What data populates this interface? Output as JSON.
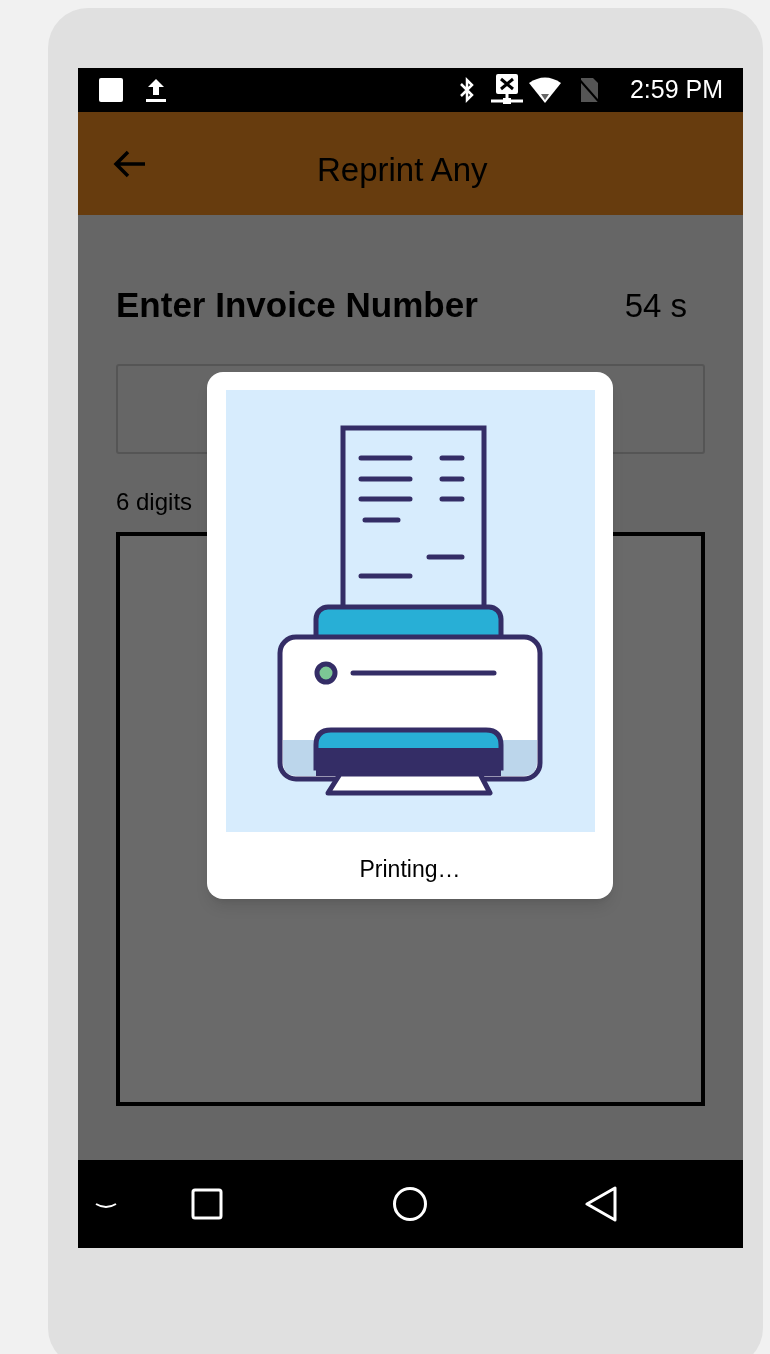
{
  "status_bar": {
    "time": "2:59 PM"
  },
  "app_bar": {
    "title": "Reprint Any"
  },
  "form": {
    "heading": "Enter Invoice Number",
    "countdown": "54 s",
    "hint": "6 digits"
  },
  "dialog": {
    "message": "Printing…"
  }
}
